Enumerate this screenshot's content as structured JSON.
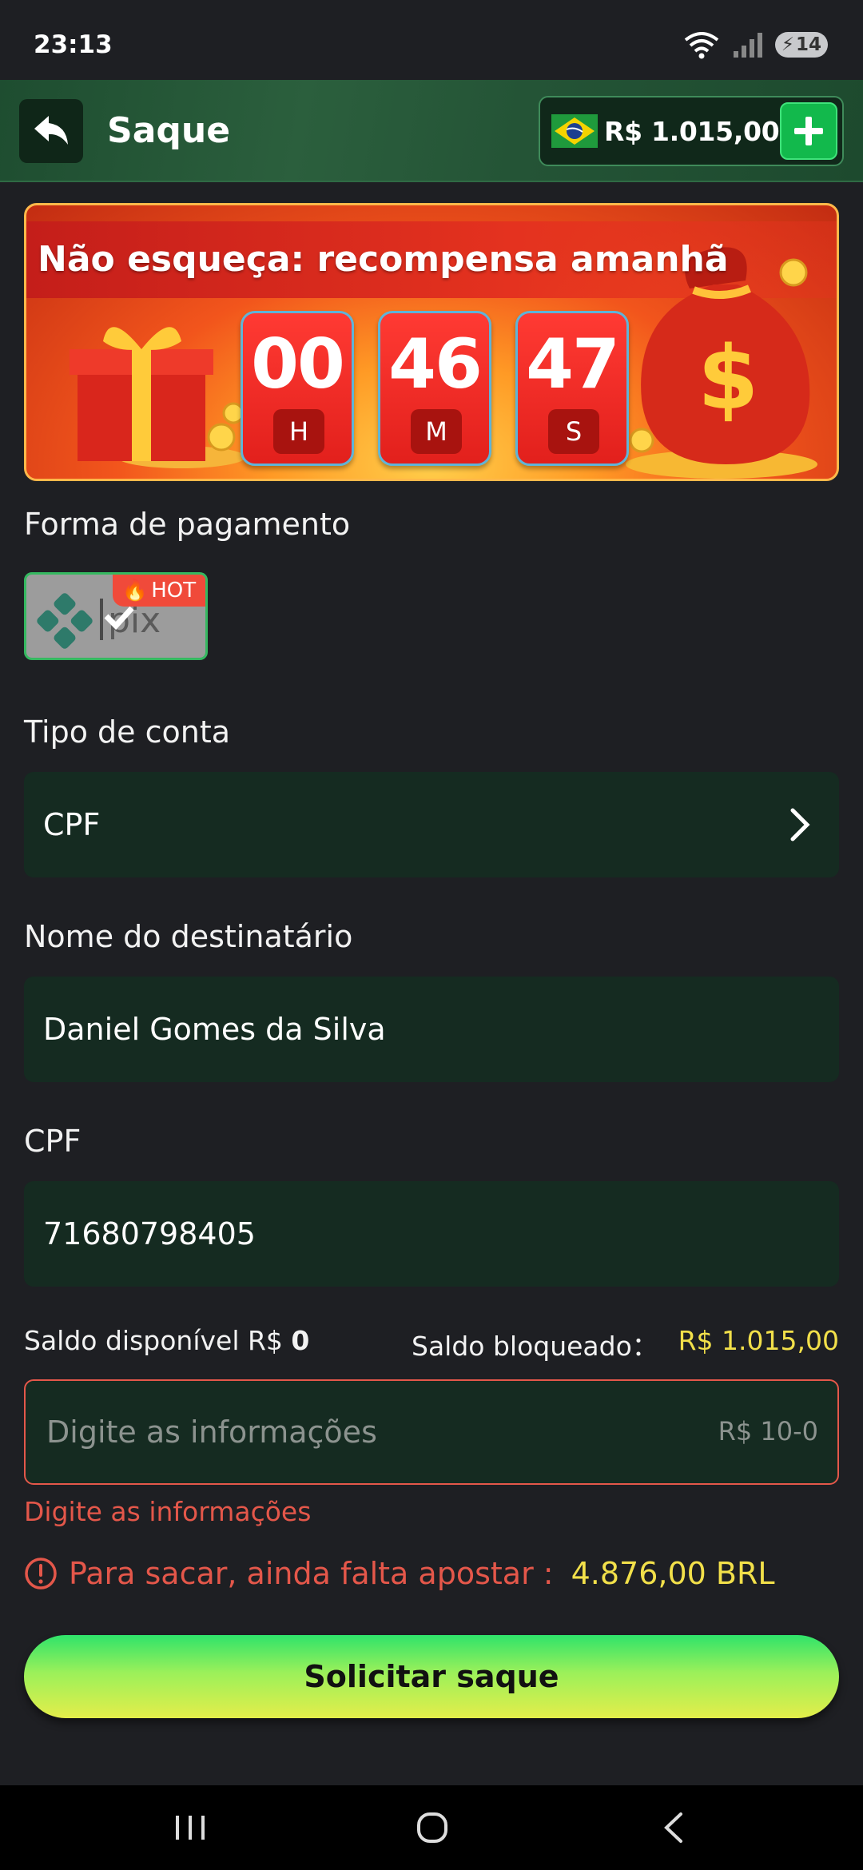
{
  "status_bar": {
    "time": "23:13",
    "battery": "14"
  },
  "header": {
    "title": "Saque",
    "balance": "R$ 1.015,00"
  },
  "banner": {
    "title": "Não esqueça: recompensa amanhã",
    "countdown": [
      {
        "value": "00",
        "unit": "H"
      },
      {
        "value": "46",
        "unit": "M"
      },
      {
        "value": "47",
        "unit": "S"
      }
    ]
  },
  "payment": {
    "label": "Forma de pagamento",
    "method_badge": "HOT"
  },
  "account_type": {
    "label": "Tipo de conta",
    "value": "CPF"
  },
  "recipient": {
    "label": "Nome do destinatário",
    "value": "Daniel Gomes da Silva"
  },
  "cpf": {
    "label": "CPF",
    "value": "71680798405"
  },
  "balances": {
    "available_label": "Saldo disponível R$ ",
    "available_value": "0",
    "blocked_label": "Saldo bloqueado：",
    "blocked_value": "R$ 1.015,00"
  },
  "amount": {
    "placeholder": "Digite as informações",
    "range": "R$ 10-0",
    "error": "Digite as informações"
  },
  "warning": {
    "text": "Para sacar, ainda falta apostar :",
    "amount": "4.876,00 BRL"
  },
  "submit": {
    "label": "Solicitar saque"
  },
  "colors": {
    "accent_green": "#12b94c",
    "error_red": "#e4574a",
    "highlight_yellow": "#f2e04a",
    "field_bg": "#152b21"
  }
}
